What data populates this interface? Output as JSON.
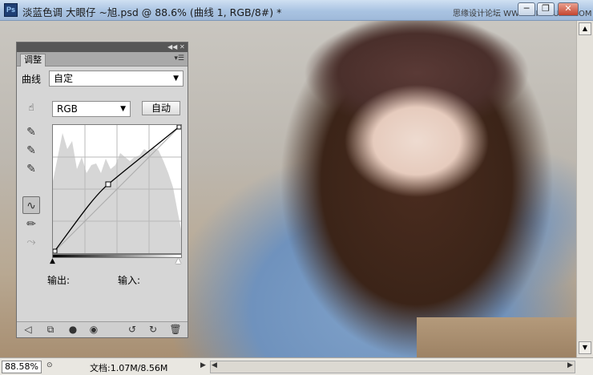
{
  "window": {
    "title": "淡蓝色调 大眼仔 ~旭.psd @ 88.6% (曲线 1, RGB/8#) *",
    "app_icon": "Ps",
    "site_text": "思缘设计论坛 WWW.MISSYUAN.COM",
    "min_label": "─",
    "max_label": "❐",
    "close_label": "✕"
  },
  "panel": {
    "tab_label": "调整",
    "curve_label": "曲线",
    "preset_value": "自定",
    "channel_value": "RGB",
    "auto_label": "自动",
    "output_label": "输出:",
    "input_label": "输入:"
  },
  "status": {
    "zoom": "88.58%",
    "doc_info": "文档:1.07M/8.56M"
  },
  "icons": {
    "hand": "hand-target-icon",
    "eyedropper": "eyedropper-icon",
    "curve_tool": "curve-point-icon",
    "pencil": "pencil-icon",
    "smooth": "smooth-icon"
  },
  "colors": {
    "title_bar": "#a9c3e2",
    "panel_bg": "#d6d6d6",
    "coat_blue": "#7fa1c9"
  }
}
